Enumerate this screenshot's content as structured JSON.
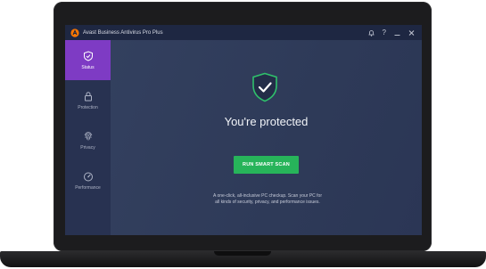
{
  "app": {
    "title": "Avast Business Antivirus Pro Plus",
    "brand_color": "#ff7800"
  },
  "titlebar_icons": [
    "bell-icon",
    "help-icon",
    "minimize-icon",
    "close-icon"
  ],
  "sidebar": {
    "items": [
      {
        "label": "Status",
        "icon": "shield-check-icon",
        "active": true
      },
      {
        "label": "Protection",
        "icon": "lock-icon",
        "active": false
      },
      {
        "label": "Privacy",
        "icon": "fingerprint-icon",
        "active": false
      },
      {
        "label": "Performance",
        "icon": "speedometer-icon",
        "active": false
      }
    ]
  },
  "main": {
    "status_icon": "shield-check-icon",
    "headline": "You're protected",
    "scan_button": "RUN SMART SCAN",
    "description": "A one-click, all-inclusive PC checkup. Scan your PC for all kinds of security, privacy, and performance issues."
  },
  "colors": {
    "accent_active": "#7e3bc4",
    "scan_button": "#27b45a",
    "shield": "#2fbf6b"
  }
}
